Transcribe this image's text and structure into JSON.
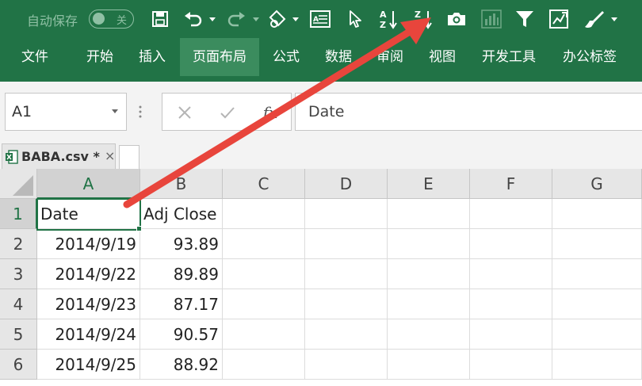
{
  "quick_access": {
    "autosave_label": "自动保存",
    "autosave_state": "关",
    "icons": [
      "save-icon",
      "undo-icon",
      "redo-icon",
      "touch-mode-icon",
      "form-icon",
      "select-pointer-icon",
      "sort-ascending-icon",
      "sort-descending-icon",
      "camera-icon",
      "chart-icon",
      "filter-icon",
      "edit-chart-icon",
      "format-painter-icon"
    ]
  },
  "ribbon_tabs": [
    {
      "label": "文件"
    },
    {
      "label": "开始"
    },
    {
      "label": "插入"
    },
    {
      "label": "页面布局"
    },
    {
      "label": "公式"
    },
    {
      "label": "数据"
    },
    {
      "label": "审阅"
    },
    {
      "label": "视图"
    },
    {
      "label": "开发工具"
    },
    {
      "label": "办公标签"
    }
  ],
  "active_tab": "页面布局",
  "name_box": "A1",
  "formula_fx": "fx",
  "formula_content": "Date",
  "workbook_tab": {
    "name": "BABA.csv *",
    "close": "×"
  },
  "columns": [
    "A",
    "B",
    "C",
    "D",
    "E",
    "F",
    "G"
  ],
  "rows": [
    "1",
    "2",
    "3",
    "4",
    "5",
    "6"
  ],
  "cells": [
    [
      "Date",
      "Adj Close"
    ],
    [
      "2014/9/19",
      "93.89"
    ],
    [
      "2014/9/22",
      "89.89"
    ],
    [
      "2014/9/23",
      "87.17"
    ],
    [
      "2014/9/24",
      "90.57"
    ],
    [
      "2014/9/25",
      "88.92"
    ]
  ],
  "colors": {
    "ribbon": "#217346",
    "active_tab": "#3b8c5e",
    "arrow": "#e8453c"
  }
}
